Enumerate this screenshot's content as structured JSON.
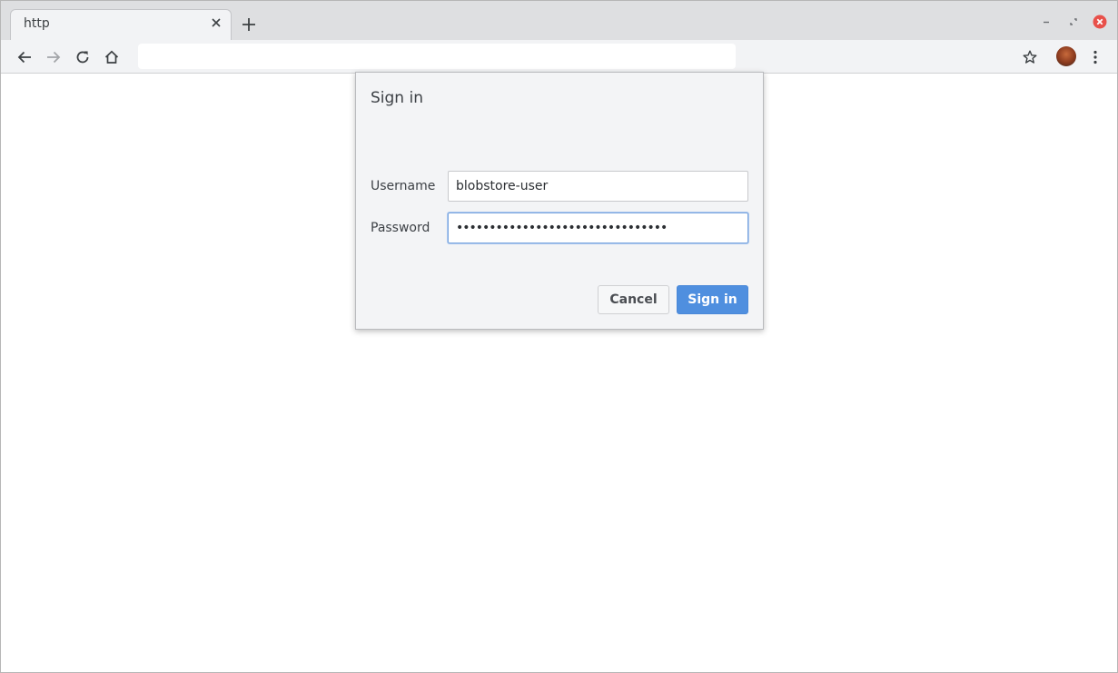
{
  "browser": {
    "tab": {
      "title": "http",
      "close_icon": "close-icon"
    },
    "new_tab_icon": "plus-icon",
    "window_controls": {
      "minimize_icon": "minimize-icon",
      "restore_icon": "restore-icon",
      "close_icon": "close-circle-icon",
      "close_color": "#e8504a"
    },
    "toolbar": {
      "back_icon": "arrow-left-icon",
      "forward_icon": "arrow-right-icon",
      "reload_icon": "reload-icon",
      "home_icon": "home-icon",
      "address_value": "",
      "bookmark_icon": "star-icon",
      "menu_icon": "kebab-menu-icon"
    }
  },
  "dialog": {
    "title": "Sign in",
    "username_label": "Username",
    "username_value": "blobstore-user",
    "password_label": "Password",
    "password_value": "••••••••••••••••••••••••••••••••",
    "cancel_label": "Cancel",
    "signin_label": "Sign in",
    "accent_color": "#4f8fdf"
  }
}
